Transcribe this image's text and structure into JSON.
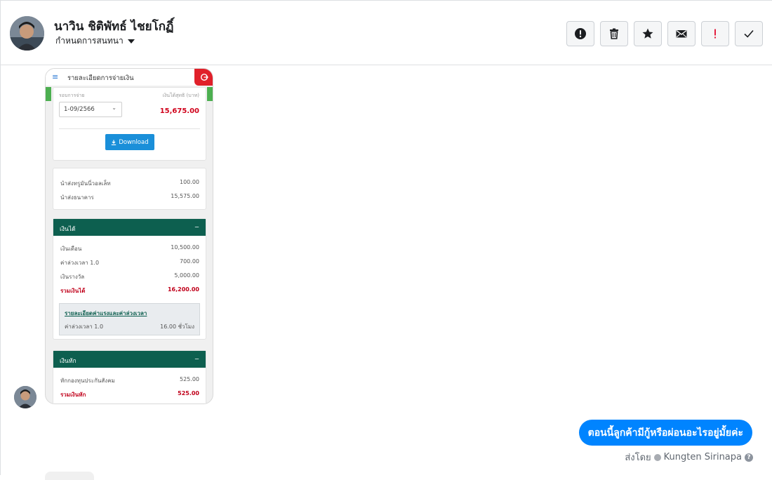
{
  "header": {
    "contact_name": "นาวิน ชิติพัทธ์ ไชยโกฏิ์",
    "assign_label": "กำหนดการสนทนา",
    "toolbar": [
      {
        "icon": "alert-circle-icon",
        "name": "mark-important-button"
      },
      {
        "icon": "trash-icon",
        "name": "delete-button"
      },
      {
        "icon": "star-icon",
        "name": "star-button"
      },
      {
        "icon": "mail-icon",
        "name": "mark-unread-button"
      },
      {
        "icon": "exclamation-icon",
        "name": "flag-button"
      },
      {
        "icon": "check-icon",
        "name": "done-button"
      }
    ]
  },
  "payslip": {
    "title": "รายละเอียดการจ่ายเงิน",
    "menu_icon": "≡",
    "period_label": "รอบการจ่าย",
    "period_value": "1-09/2566",
    "net_label": "เงินได้สุทธิ (บาท)",
    "net_value": "15,675.00",
    "download_label": "Download",
    "transfers": [
      {
        "label": "นำส่งทรูมันนี่วอลเล็ท",
        "value": "100.00"
      },
      {
        "label": "นำส่งธนาคาร",
        "value": "15,575.00"
      }
    ],
    "income": {
      "heading": "เงินได้",
      "toggle": "−",
      "rows": [
        {
          "label": "เงินเดือน",
          "value": "10,500.00"
        },
        {
          "label": "ค่าล่วงเวลา 1.0",
          "value": "700.00"
        },
        {
          "label": "เงินรางวัล",
          "value": "5,000.00"
        }
      ],
      "total_label": "รวมเงินได้",
      "total_value": "16,200.00",
      "ot_link": "รายละเอียดค่าแรงและค่าล่วงเวลา",
      "ot_label": "ค่าล่วงเวลา 1.0",
      "ot_value": "16.00 ชั่วโมง"
    },
    "deduction": {
      "heading": "เงินหัก",
      "toggle": "−",
      "rows": [
        {
          "label": "หักกองทุนประกันสังคม",
          "value": "525.00"
        }
      ],
      "total_label": "รวมเงินหัก",
      "total_value": "525.00"
    }
  },
  "outgoing": {
    "message": "ตอนนี้ลูกค้ามีกู้หรือผ่อนอะไรอยู่มั้ยค่ะ",
    "sent_by_prefix": "ส่งโดย",
    "sender": "Kungten Sirinapa",
    "help": "?"
  },
  "colors": {
    "bubble": "#0084ff",
    "section_header": "#0d5f4f",
    "accent_red": "#d0021b",
    "download": "#1a8fd9"
  }
}
